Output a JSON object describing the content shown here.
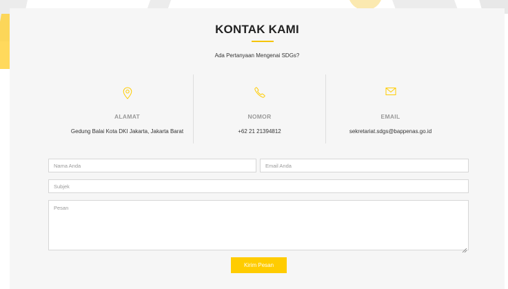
{
  "section": {
    "title": "KONTAK KAMI",
    "subtitle": "Ada Pertanyaan Mengenai SDGs?"
  },
  "info": [
    {
      "label": "ALAMAT",
      "value": "Gedung Balai Kota DKI Jakarta, Jakarta Barat",
      "icon": "map-pin-icon"
    },
    {
      "label": "NOMOR",
      "value": "+62 21 21394812",
      "icon": "phone-icon"
    },
    {
      "label": "EMAIL",
      "value": "sekretariat.sdgs@bappenas.go.id",
      "icon": "envelope-icon"
    }
  ],
  "form": {
    "name_placeholder": "Nama Anda",
    "email_placeholder": "Email Anda",
    "subject_placeholder": "Subjek",
    "message_placeholder": "Pesan",
    "submit_label": "Kirim Pesan"
  },
  "colors": {
    "accent": "#ffcc00",
    "panel_background": "#f6f6f6"
  }
}
